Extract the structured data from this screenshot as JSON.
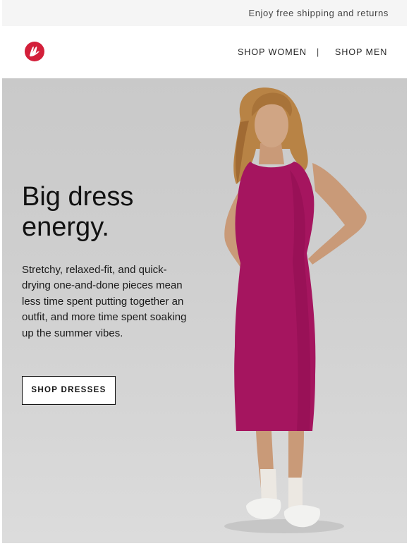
{
  "promo": {
    "text": "Enjoy free shipping and returns"
  },
  "header": {
    "logo_icon": "lululemon-logo-icon",
    "nav": {
      "women": "SHOP WOMEN",
      "separator": "|",
      "men": "SHOP MEN"
    }
  },
  "hero": {
    "headline": "Big dress energy.",
    "body": "Stretchy, relaxed-fit, and quick-drying one-and-done pieces mean less time spent putting together an outfit, and more time spent soaking up the summer vibes.",
    "cta_label": "SHOP DRESSES",
    "image_subject": "model-in-magenta-dress"
  },
  "colors": {
    "brand_red": "#d31f3a",
    "dress_magenta": "#a5155f",
    "hero_background": "#cdcdcd"
  }
}
